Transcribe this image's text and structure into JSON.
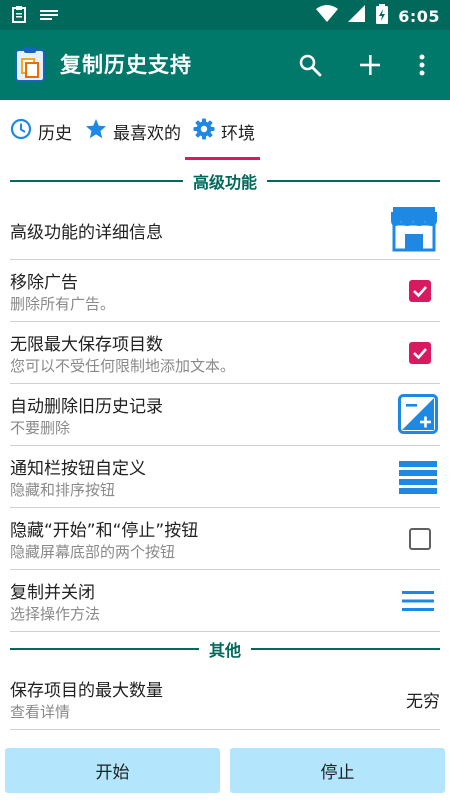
{
  "status_bar": {
    "time": "6:05"
  },
  "app_bar": {
    "title": "复制历史支持"
  },
  "tabs": [
    {
      "label": "历史",
      "icon": "clock-icon"
    },
    {
      "label": "最喜欢的",
      "icon": "star-icon"
    },
    {
      "label": "环境",
      "icon": "gear-icon",
      "selected": true
    }
  ],
  "sections": {
    "advanced": "高级功能",
    "other": "其他"
  },
  "settings": {
    "advanced_info": {
      "title": "高级功能的详细信息",
      "icon": "store-icon"
    },
    "remove_ads": {
      "title": "移除广告",
      "subtitle": "删除所有广告。",
      "checked": true
    },
    "unlimited_items": {
      "title": "无限最大保存项目数",
      "subtitle": "您可以不受任何限制地添加文本。",
      "checked": true
    },
    "auto_delete": {
      "title": "自动删除旧历史记录",
      "subtitle": "不要删除",
      "icon": "plus-minus-icon"
    },
    "notification_buttons": {
      "title": "通知栏按钮自定义",
      "subtitle": "隐藏和排序按钮",
      "icon": "rows-icon"
    },
    "hide_start_stop": {
      "title": "隐藏“开始”和“停止”按钮",
      "subtitle": "隐藏屏幕底部的两个按钮",
      "checked": false
    },
    "copy_close": {
      "title": "复制并关闭",
      "subtitle": "选择操作方法",
      "icon": "menu-icon"
    },
    "max_items": {
      "title": "保存项目的最大数量",
      "subtitle": "查看详情",
      "value": "无穷"
    }
  },
  "bottom_buttons": {
    "start": "开始",
    "stop": "停止"
  },
  "colors": {
    "primary": "#00796b",
    "primary_dark": "#00695c",
    "accent": "#d81b60",
    "icon_blue": "#1e88e5",
    "button_bg": "#b3e5fc"
  }
}
